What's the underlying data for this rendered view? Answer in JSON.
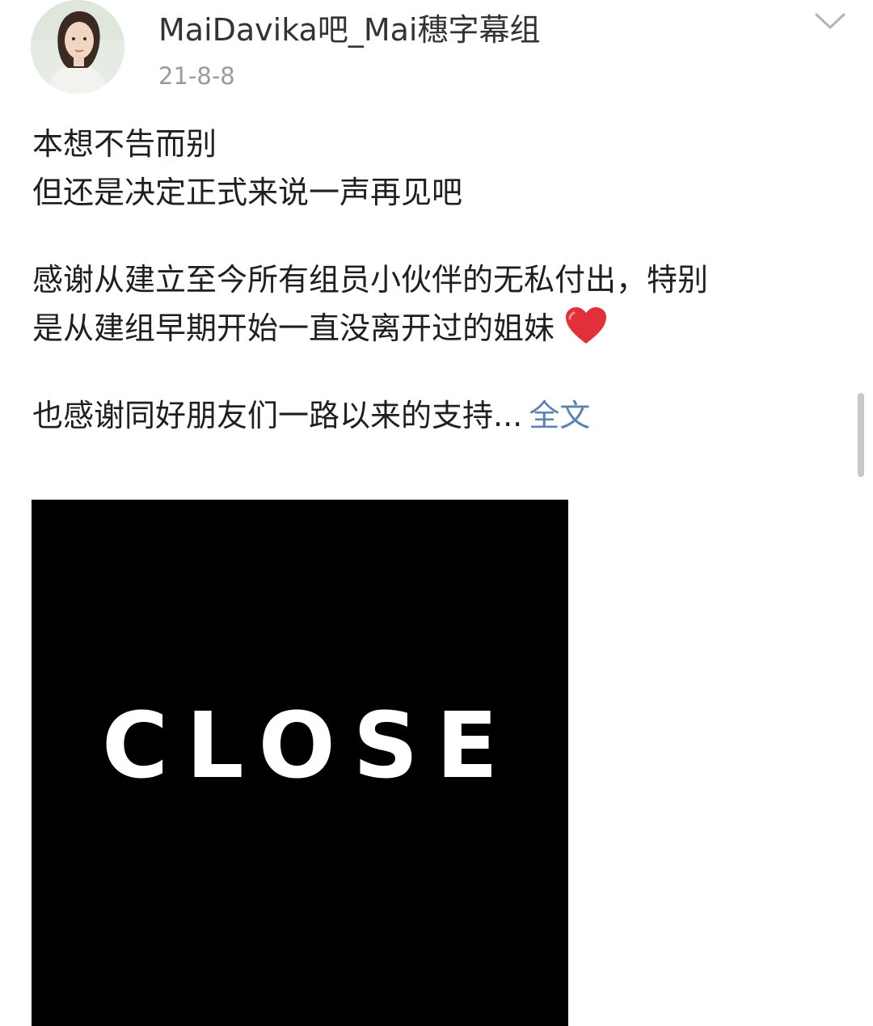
{
  "post": {
    "author_name": "MaiDavika吧_Mai穗字幕组",
    "date": "21-8-8",
    "lines": {
      "l1": "本想不告而别",
      "l2": "但还是决定正式来说一声再见吧",
      "l3": "感谢从建立至今所有组员小伙伴的无私付出，特别",
      "l4": "是从建组早期开始一直没离开过的姐妹",
      "l5": "也感谢同好朋友们一路以来的支持..."
    },
    "full_text_label": "全文",
    "image_text": "CLOSE"
  },
  "icons": {
    "menu": "chevron-down-icon",
    "heart": "red-heart-emoji"
  },
  "colors": {
    "link": "#5b83b6",
    "date": "#9a9a9a",
    "heart": "#e2303a"
  }
}
